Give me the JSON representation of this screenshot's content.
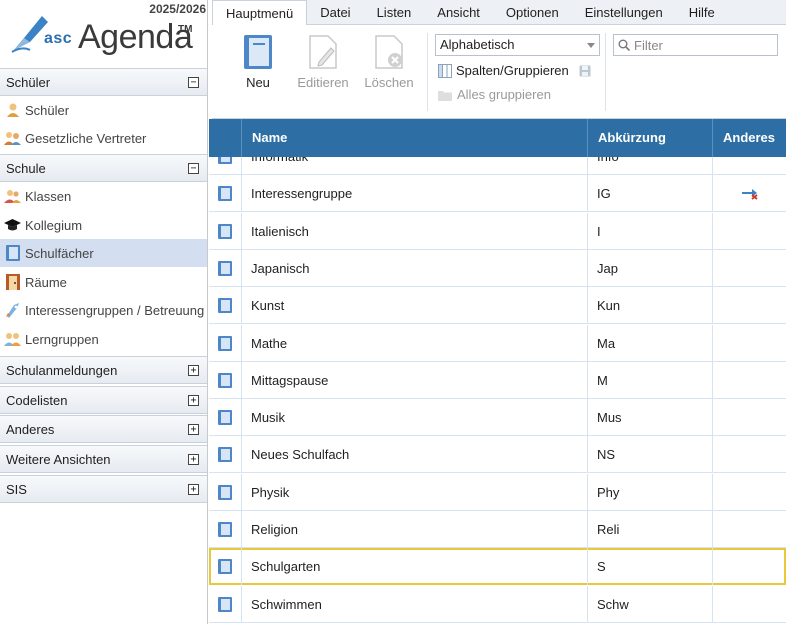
{
  "sidebar": {
    "year": "2025/2026",
    "logo": {
      "asc": "asc",
      "agenda": "Agenda",
      "tm": "TM"
    },
    "sections": [
      {
        "label": "Schüler",
        "toggle": "−",
        "items": [
          {
            "label": "Schüler",
            "icon": "student-icon"
          },
          {
            "label": "Gesetzliche Vertreter",
            "icon": "guardians-icon"
          }
        ]
      },
      {
        "label": "Schule",
        "toggle": "−",
        "items": [
          {
            "label": "Klassen",
            "icon": "classes-icon"
          },
          {
            "label": "Kollegium",
            "icon": "graduation-cap-icon"
          },
          {
            "label": "Schulfächer",
            "icon": "subject-book-icon",
            "active": true
          },
          {
            "label": "Räume",
            "icon": "room-door-icon"
          },
          {
            "label": "Interessengruppen / Betreuung",
            "icon": "interest-group-icon"
          },
          {
            "label": "Lerngruppen",
            "icon": "study-group-icon"
          }
        ]
      },
      {
        "label": "Schulanmeldungen",
        "toggle": "+"
      },
      {
        "label": "Codelisten",
        "toggle": "+"
      },
      {
        "label": "Anderes",
        "toggle": "+"
      },
      {
        "label": "Weitere Ansichten",
        "toggle": "+"
      },
      {
        "label": "SIS",
        "toggle": "+"
      }
    ]
  },
  "menu": {
    "tabs": [
      "Hauptmenü",
      "Datei",
      "Listen",
      "Ansicht",
      "Optionen",
      "Einstellungen",
      "Hilfe"
    ],
    "active_tab": "Hauptmenü"
  },
  "ribbon": {
    "new_label": "Neu",
    "edit_label": "Editieren",
    "delete_label": "Löschen",
    "sort_value": "Alphabetisch",
    "columns_label": "Spalten/Gruppieren",
    "group_all_label": "Alles gruppieren",
    "filter_placeholder": "Filter"
  },
  "grid": {
    "columns": [
      "Name",
      "Abkürzung",
      "Anderes"
    ],
    "rows": [
      {
        "name": "Informatik",
        "abbr": "Info",
        "other": ""
      },
      {
        "name": "Interessengruppe",
        "abbr": "IG",
        "other": "link-icon"
      },
      {
        "name": "Italienisch",
        "abbr": "I",
        "other": ""
      },
      {
        "name": "Japanisch",
        "abbr": "Jap",
        "other": ""
      },
      {
        "name": "Kunst",
        "abbr": "Kun",
        "other": ""
      },
      {
        "name": "Mathe",
        "abbr": "Ma",
        "other": ""
      },
      {
        "name": "Mittagspause",
        "abbr": "M",
        "other": ""
      },
      {
        "name": "Musik",
        "abbr": "Mus",
        "other": ""
      },
      {
        "name": "Neues Schulfach",
        "abbr": "NS",
        "other": ""
      },
      {
        "name": "Physik",
        "abbr": "Phy",
        "other": ""
      },
      {
        "name": "Religion",
        "abbr": "Reli",
        "other": ""
      },
      {
        "name": "Schulgarten",
        "abbr": "S",
        "other": "",
        "selected": true
      },
      {
        "name": "Schwimmen",
        "abbr": "Schw",
        "other": ""
      }
    ]
  },
  "colors": {
    "header_blue": "#2d6ea4",
    "selection_outline": "#e8c93a",
    "active_nav": "#d3dff0",
    "book_icon": "#4d86c9"
  }
}
